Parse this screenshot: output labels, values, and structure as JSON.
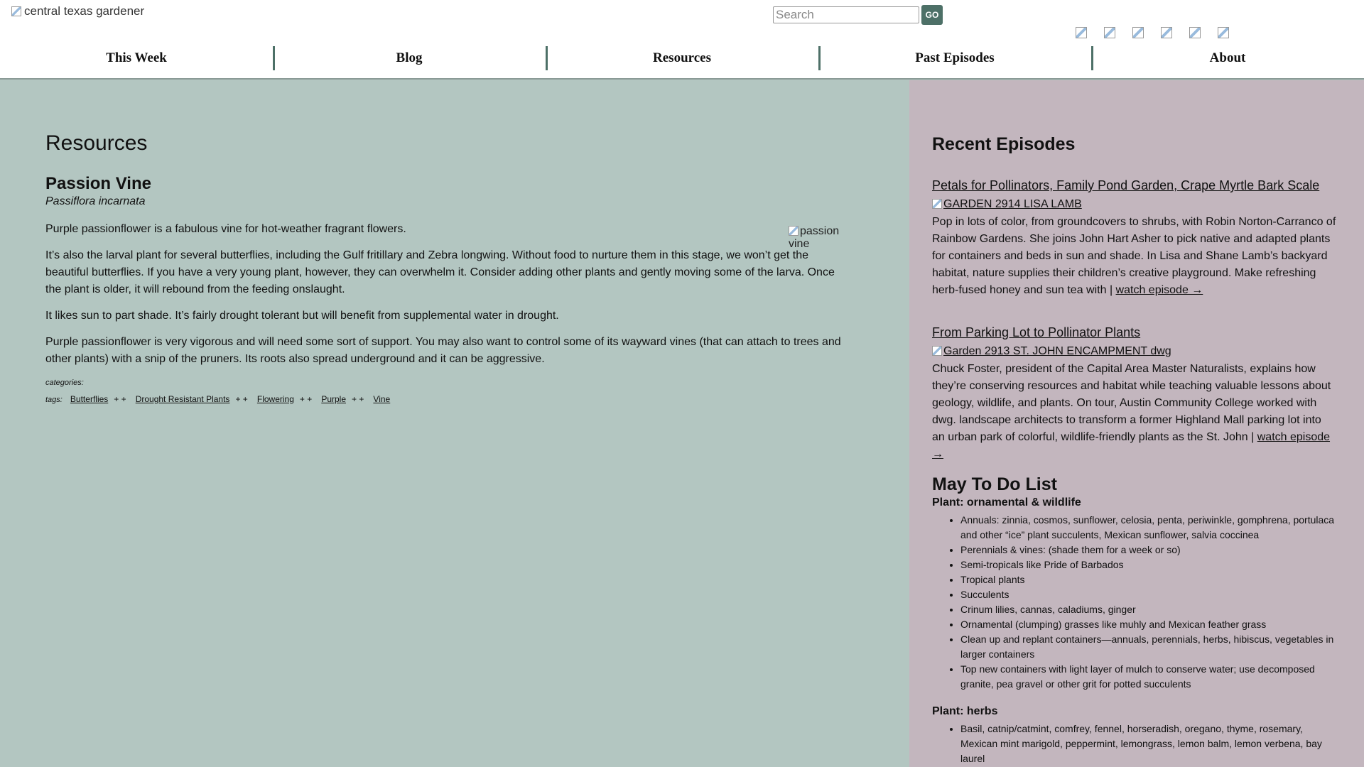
{
  "header": {
    "logo_alt": "central texas gardener",
    "search_placeholder": "Search",
    "search_button": "GO",
    "social_icons": [
      "facebook-icon",
      "twitter-icon",
      "instagram-icon",
      "youtube-icon",
      "pinterest-icon",
      "email-icon"
    ]
  },
  "nav": [
    "This Week",
    "Blog",
    "Resources",
    "Past Episodes",
    "About"
  ],
  "main": {
    "heading": "Resources",
    "plant_name": "Passion Vine",
    "plant_latin": "Passiflora incarnata",
    "image_alt": "passion vine",
    "paragraphs": [
      "Purple passionflower is a fabulous vine for hot-weather fragrant flowers.",
      "It’s also the larval plant for several butterflies, including the Gulf fritillary and Zebra longwing.  Without food to nurture them in this stage, we won’t get the beautiful butterflies. If you have a very young plant, however, they can overwhelm it.  Consider adding other plants and gently moving some of the larva. Once the plant is older, it will rebound from the feeding onslaught.",
      "It likes sun to part shade.  It’s fairly drought tolerant but will benefit from supplemental water in drought.",
      "Purple passionflower is very vigorous and will need some sort of support.  You may also want to control some of its wayward vines (that can attach to trees and other plants) with a snip of the pruners.  Its roots also spread underground and it can be aggressive."
    ],
    "categories_label": "categories:",
    "tags_label": "tags:",
    "tags": [
      "Butterflies",
      "Drought Resistant Plants",
      "Flowering",
      "Purple",
      "Vine"
    ],
    "tag_plus": "+ +"
  },
  "sidebar": {
    "recent_title": "Recent Episodes",
    "episodes": [
      {
        "title": "Petals for Pollinators, Family Pond Garden, Crape Myrtle Bark Scale",
        "image_alt": "GARDEN 2914 LISA LAMB",
        "description": "Pop in lots of color, from groundcovers to shrubs, with Robin Norton-Carranco of Rainbow Gardens. She joins John Hart Asher to pick native and adapted plants for containers and beds in sun and shade. In Lisa and Shane Lamb’s backyard habitat, nature supplies their children’s creative playground. Make refreshing herb-fused honey and sun tea with | ",
        "link": "watch episode →"
      },
      {
        "title": "From Parking Lot to Pollinator Plants",
        "image_alt": "Garden 2913 ST. JOHN ENCAMPMENT dwg",
        "description": "Chuck Foster, president of the Capital Area Master Naturalists, explains how they’re conserving resources and habitat while teaching valuable lessons about geology, wildlife, and plants. On tour, Austin Community College worked with dwg. landscape architects to transform a former Highland Mall parking lot into an urban park of colorful, wildlife-friendly plants as the St. John | ",
        "link": "watch episode →"
      }
    ],
    "todo": {
      "title": "May To Do List",
      "section1": "Plant: ornamental & wildlife",
      "items1": [
        "Annuals:  zinnia, cosmos, sunflower, celosia, penta, periwinkle, gomphrena, portulaca and other “ice” plant succulents, Mexican sunflower, salvia coccinea",
        "Perennials & vines:  (shade them for a week or so)",
        "Semi-tropicals like Pride of Barbados",
        "Tropical plants",
        "Succulents",
        "Crinum lilies, cannas, caladiums, ginger",
        "Ornamental (clumping) grasses like muhly and Mexican feather grass",
        "Clean up and replant containers—annuals, perennials, herbs, hibiscus, vegetables in larger containers",
        "Top new containers with light layer of mulch to conserve water; use decomposed granite, pea gravel or other grit for potted succulents"
      ],
      "section2": "Plant: herbs",
      "items2": [
        "Basil, catnip/catmint, comfrey, fennel, horseradish, oregano, thyme, rosemary, Mexican mint marigold, peppermint, lemongrass, lemon balm, lemon verbena, bay laurel"
      ]
    }
  },
  "colors": {
    "main_bg": "#b3c6c1",
    "sidebar_bg": "#c3b6be",
    "accent": "#4d7067"
  }
}
